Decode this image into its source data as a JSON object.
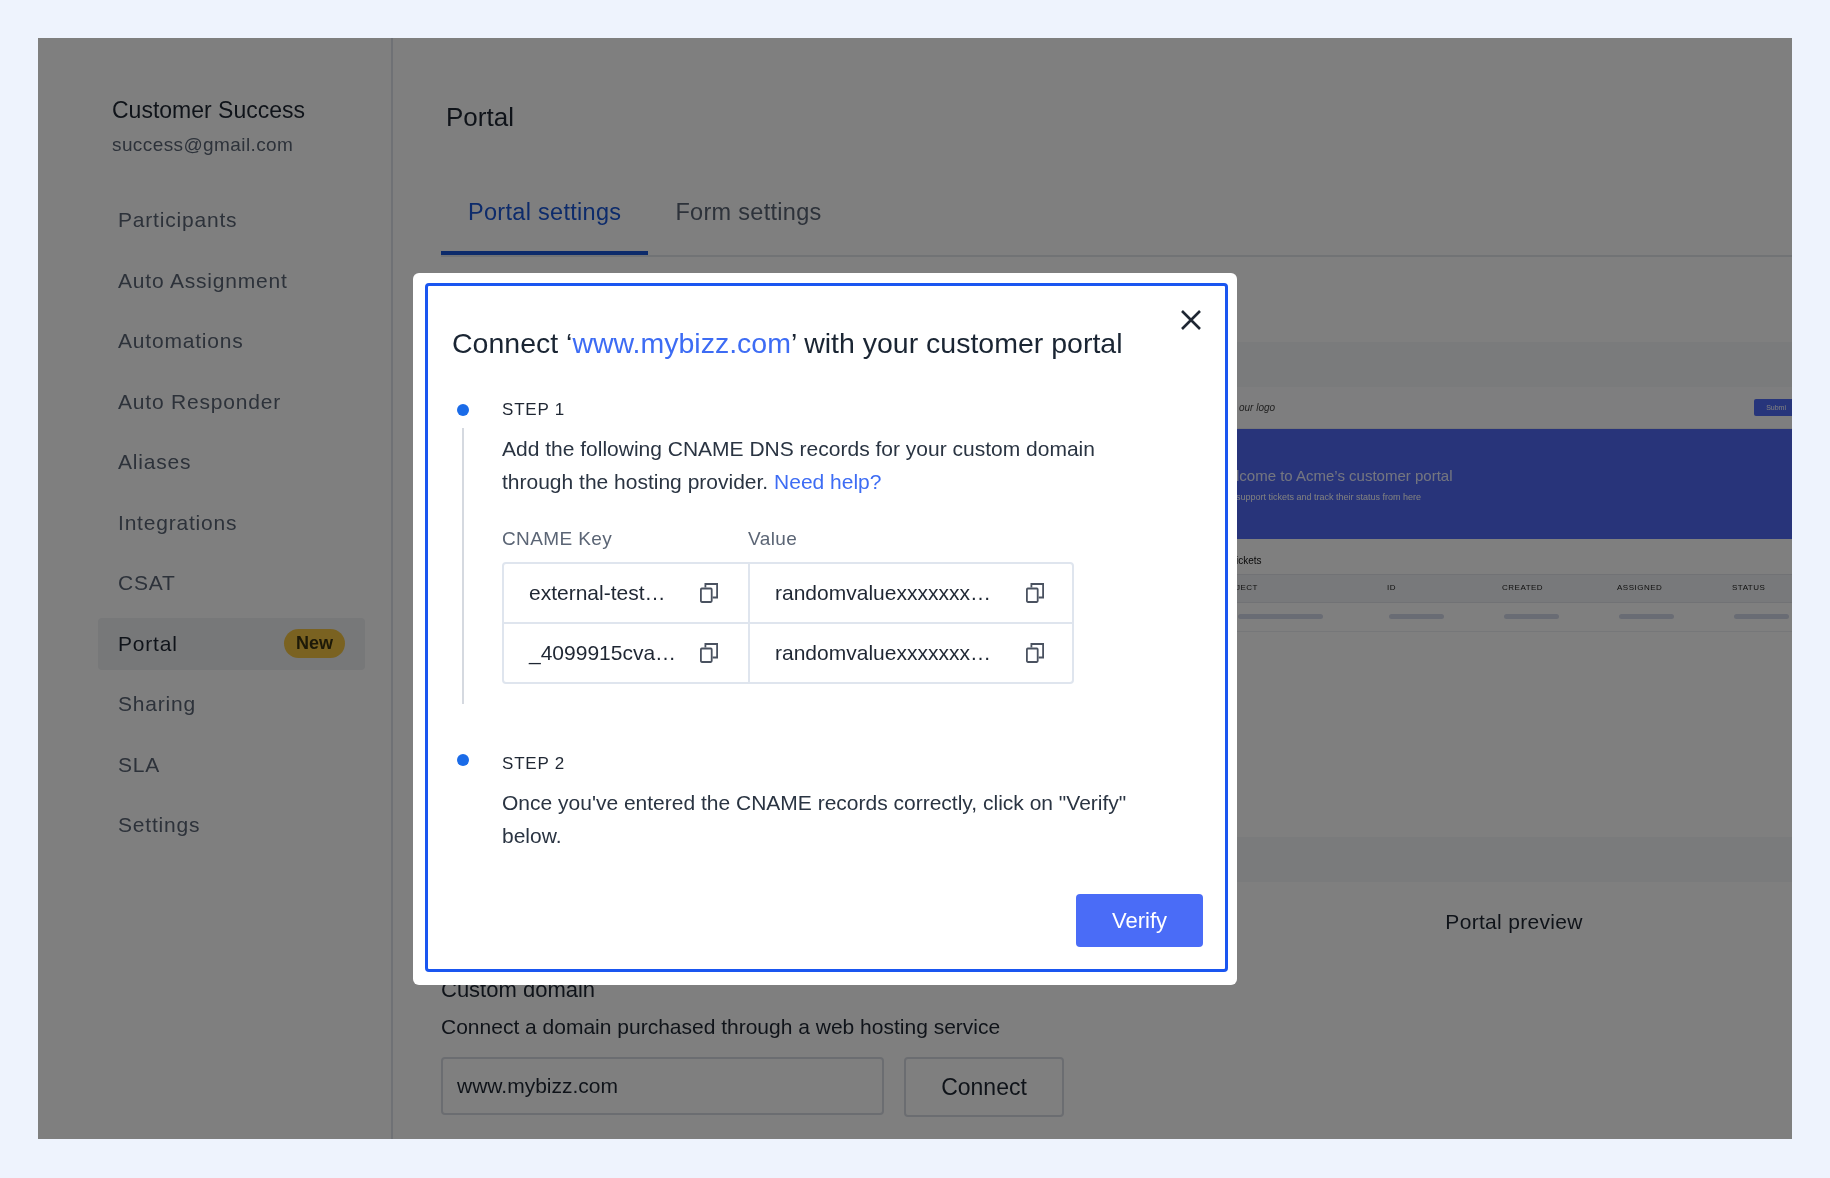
{
  "sidebar": {
    "name": "Customer Success",
    "email": "success@gmail.com",
    "items": [
      {
        "label": "Participants",
        "selected": false
      },
      {
        "label": "Auto Assignment",
        "selected": false
      },
      {
        "label": "Automations",
        "selected": false
      },
      {
        "label": "Auto Responder",
        "selected": false
      },
      {
        "label": "Aliases",
        "selected": false
      },
      {
        "label": "Integrations",
        "selected": false
      },
      {
        "label": "CSAT",
        "selected": false
      },
      {
        "label": "Portal",
        "selected": true,
        "badge": "New"
      },
      {
        "label": "Sharing",
        "selected": false
      },
      {
        "label": "SLA",
        "selected": false
      },
      {
        "label": "Settings",
        "selected": false
      }
    ]
  },
  "page": {
    "title": "Portal"
  },
  "tabs": [
    {
      "label": "Portal settings",
      "selected": true
    },
    {
      "label": "Form settings",
      "selected": false
    }
  ],
  "preview": {
    "logo": "our logo",
    "button": "Submi",
    "heading": "lcome to Acme’s customer portal",
    "subheading": "support tickets and track their status from here",
    "section": "ickets",
    "columns": [
      "JECT",
      "ID",
      "CREATED",
      "ASSIGNED",
      "STATUS"
    ],
    "caption": "Portal preview"
  },
  "custom_domain": {
    "heading": "Custom domain",
    "description": "Connect a domain purchased through a web hosting service",
    "value": "www.mybizz.com",
    "button": "Connect"
  },
  "dialog": {
    "title_before": "Connect ‘",
    "domain": "www.mybizz.com",
    "title_after": "’ with your customer portal",
    "steps": [
      {
        "label": "STEP 1",
        "text": "Add the following CNAME DNS records for your custom domain through the hosting provider.",
        "link": "Need help?",
        "records": {
          "columns": [
            "CNAME Key",
            "Value"
          ],
          "rows": [
            [
              "external-test…",
              "randomvaluexxxxxxx…"
            ],
            [
              "_4099915cva…",
              "randomvaluexxxxxxx…"
            ]
          ]
        }
      },
      {
        "label": "STEP 2",
        "text": "Once you've entered the CNAME records correctly, click on \"Verify\" below."
      }
    ],
    "button": "Verify"
  }
}
